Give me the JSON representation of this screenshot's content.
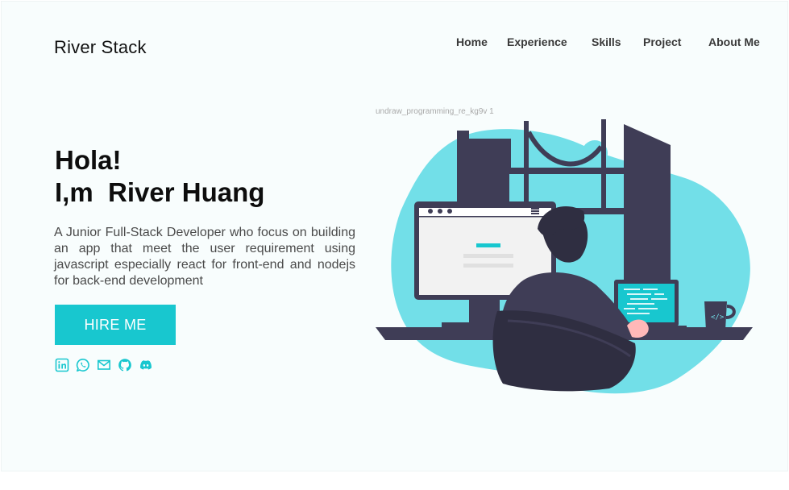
{
  "brand": {
    "name": "River Stack"
  },
  "nav": {
    "items": [
      {
        "label": "Home"
      },
      {
        "label": "Experience"
      },
      {
        "label": "Skills"
      },
      {
        "label": "Project"
      },
      {
        "label": "About Me"
      }
    ]
  },
  "hero": {
    "greeting": "Hola!",
    "name_line": "I,m  River Huang",
    "description": "A Junior Full-Stack Developer who focus on building an app that meet the user requirement using javascript  especially react for front-end and nodejs for back-end development",
    "cta_label": "HIRE ME"
  },
  "socials": [
    {
      "icon": "linkedin-icon"
    },
    {
      "icon": "whatsapp-icon"
    },
    {
      "icon": "mail-icon"
    },
    {
      "icon": "github-icon"
    },
    {
      "icon": "discord-icon"
    }
  ],
  "illustration": {
    "caption": "undraw_programming_re_kg9v 1"
  },
  "colors": {
    "accent": "#18c7cf",
    "blob": "#72dfe8",
    "dark": "#3f3d56",
    "background": "#f8fdfd"
  }
}
